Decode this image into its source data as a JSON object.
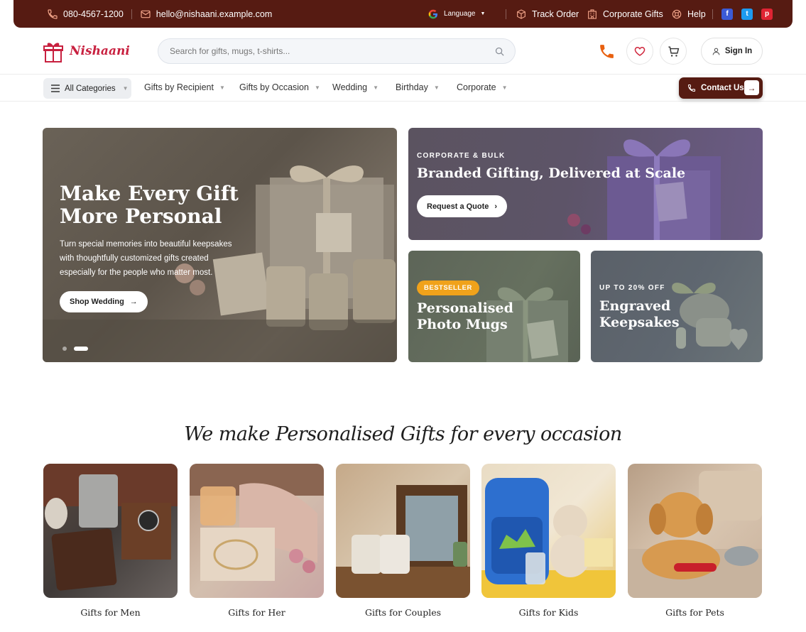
{
  "topbar": {
    "phone": "080-4567-1200",
    "email": "hello@nishaani.example.com",
    "language": "Language",
    "track_order": "Track Order",
    "corporate_gifts": "Corporate Gifts",
    "help": "Help",
    "social": [
      "facebook-icon",
      "twitter-icon",
      "pinterest-icon"
    ]
  },
  "header": {
    "logo_text": "Nishaani",
    "search_placeholder": "Search for gifts, mugs, t-shirts...",
    "sign_in": "Sign In"
  },
  "nav": {
    "all_categories": "All Categories",
    "items": [
      "Gifts by Recipient",
      "Gifts by Occasion",
      "Wedding",
      "Birthday",
      "Corporate"
    ],
    "contact": "Contact Us"
  },
  "hero": {
    "title_line1": "Make Every Gift",
    "title_line2": "More Personal",
    "text_line1": "Turn special memories into beautiful keepsakes",
    "text_line2": "with thoughtfully customized gifts created",
    "text_line3": "especially for the people who matter most.",
    "cta": "Shop Wedding"
  },
  "promo_corporate": {
    "eyebrow": "CORPORATE & BULK",
    "title": "Branded Gifting, Delivered at Scale",
    "cta": "Request a Quote"
  },
  "promo_mugs": {
    "badge": "BESTSELLER",
    "title_line1": "Personalised",
    "title_line2": "Photo Mugs"
  },
  "promo_keepsakes": {
    "eyebrow": "UP TO 20% OFF",
    "title_line1": "Engraved",
    "title_line2": "Keepsakes"
  },
  "section": {
    "title": "We make Personalised Gifts for every occasion",
    "categories": [
      "Gifts for Men",
      "Gifts for Her",
      "Gifts for Couples",
      "Gifts for Kids",
      "Gifts for Pets"
    ]
  },
  "colors": {
    "brand": "#561b12",
    "accent": "#c8203f",
    "badge": "#f0a21b"
  }
}
